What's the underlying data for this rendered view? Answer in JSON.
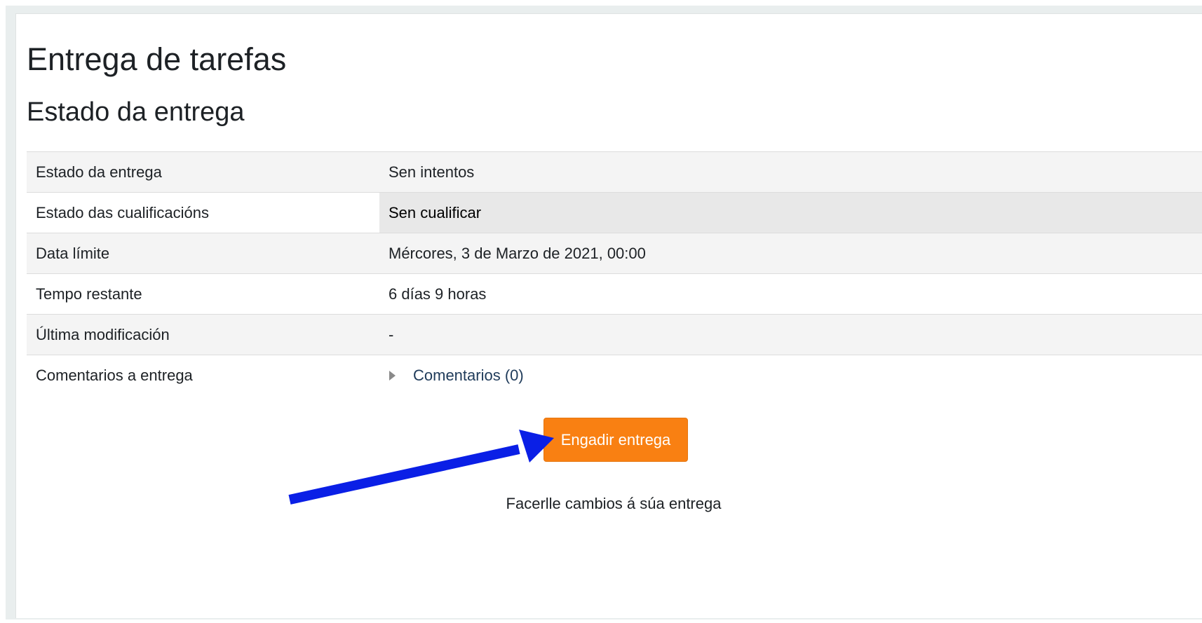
{
  "page": {
    "title": "Entrega de tarefas",
    "section_title": "Estado da entrega"
  },
  "status_table": {
    "rows": [
      {
        "label": "Estado da entrega",
        "value": "Sen intentos"
      },
      {
        "label": "Estado das cualificacións",
        "value": "Sen cualificar"
      },
      {
        "label": "Data límite",
        "value": "Mércores, 3 de Marzo de 2021, 00:00"
      },
      {
        "label": "Tempo restante",
        "value": "6 días 9 horas"
      },
      {
        "label": "Última modificación",
        "value": "-"
      },
      {
        "label": "Comentarios a entrega",
        "value": "Comentarios (0)"
      }
    ]
  },
  "actions": {
    "add_submission_label": "Engadir entrega",
    "help_text": "Facerlle cambios á súa entrega"
  },
  "colors": {
    "button": "#f98012",
    "arrow": "#0a1fe6",
    "frame": "#e9eeee"
  },
  "icons": {
    "expand": "chevron-right-icon",
    "annotation": "arrow-annotation-icon"
  }
}
